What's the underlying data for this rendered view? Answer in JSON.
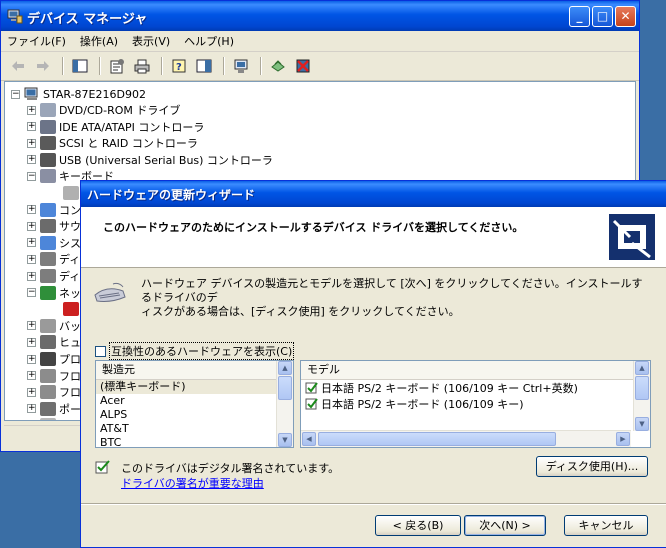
{
  "device_manager": {
    "title": "デバイス マネージャ",
    "menu": [
      "ファイル(F)",
      "操作(A)",
      "表示(V)",
      "ヘルプ(H)"
    ],
    "tree": {
      "root": "STAR-87E216D902",
      "items": [
        {
          "label": "DVD/CD-ROM ドライブ"
        },
        {
          "label": "IDE ATA/ATAPI コントローラ"
        },
        {
          "label": "SCSI と RAID コントローラ"
        },
        {
          "label": "USB (Universal Serial Bus) コントローラ"
        },
        {
          "label": "キーボード"
        },
        {
          "label": ""
        },
        {
          "label": "コン"
        },
        {
          "label": "サウ"
        },
        {
          "label": "シス"
        },
        {
          "label": "ディ"
        },
        {
          "label": "ディ"
        },
        {
          "label": "ネッ"
        },
        {
          "label": ""
        },
        {
          "label": "バッ"
        },
        {
          "label": "ヒュ"
        },
        {
          "label": "プロ"
        },
        {
          "label": "フロ"
        },
        {
          "label": "フロ"
        },
        {
          "label": "ポー"
        },
        {
          "label": "マウ"
        }
      ]
    }
  },
  "wizard": {
    "title": "ハードウェアの更新ウィザード",
    "header_title": "このハードウェアのためにインストールするデバイス ドライバを選択してください。",
    "intro_line1": "ハードウェア デバイスの製造元とモデルを選択して [次へ] をクリックしてください。インストールするドライバのデ",
    "intro_line2": "ィスクがある場合は、[ディスク使用] をクリックしてください。",
    "compat_label": "互換性のあるハードウェアを表示(C)",
    "manufacturer_header": "製造元",
    "manufacturers": [
      "(標準キーボード)",
      "Acer",
      "ALPS",
      "AT&T",
      "BTC"
    ],
    "model_header": "モデル",
    "models": [
      "日本語 PS/2 キーボード (106/109 キー Ctrl+英数)",
      "日本語 PS/2 キーボード (106/109 キー)"
    ],
    "signature_text": "このドライバはデジタル署名されています。",
    "signature_link": "ドライバの署名が重要な理由",
    "disk_button": "ディスク使用(H)...",
    "back_button": "< 戻る(B)",
    "next_button": "次へ(N) >",
    "cancel_button": "キャンセル"
  }
}
